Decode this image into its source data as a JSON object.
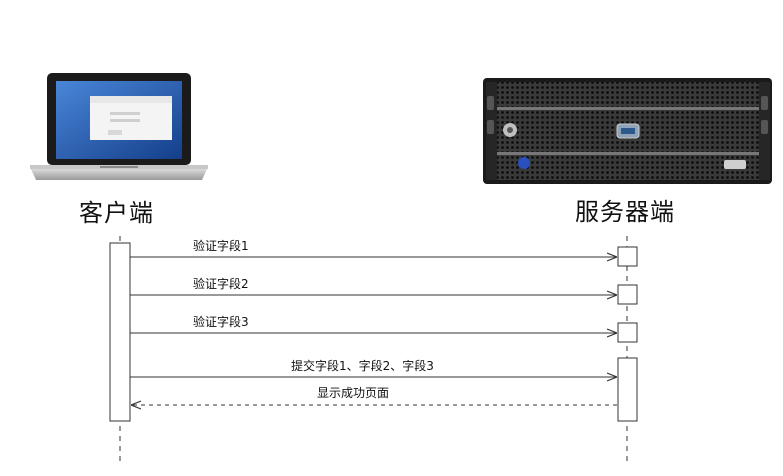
{
  "actors": {
    "client": {
      "label": "客户端"
    },
    "server": {
      "label": "服务器端"
    }
  },
  "messages": [
    {
      "label": "验证字段1",
      "direction": "client-to-server",
      "style": "solid"
    },
    {
      "label": "验证字段2",
      "direction": "client-to-server",
      "style": "solid"
    },
    {
      "label": "验证字段3",
      "direction": "client-to-server",
      "style": "solid"
    },
    {
      "label": "提交字段1、字段2、字段3",
      "direction": "client-to-server",
      "style": "solid"
    },
    {
      "label": "显示成功页面",
      "direction": "server-to-client",
      "style": "dashed"
    }
  ],
  "colors": {
    "line": "#333333",
    "laptop_screen": "#1f5fb8",
    "server_body": "#2a2a2a"
  },
  "icons": {
    "client": "laptop-icon",
    "server": "rack-server-icon"
  }
}
